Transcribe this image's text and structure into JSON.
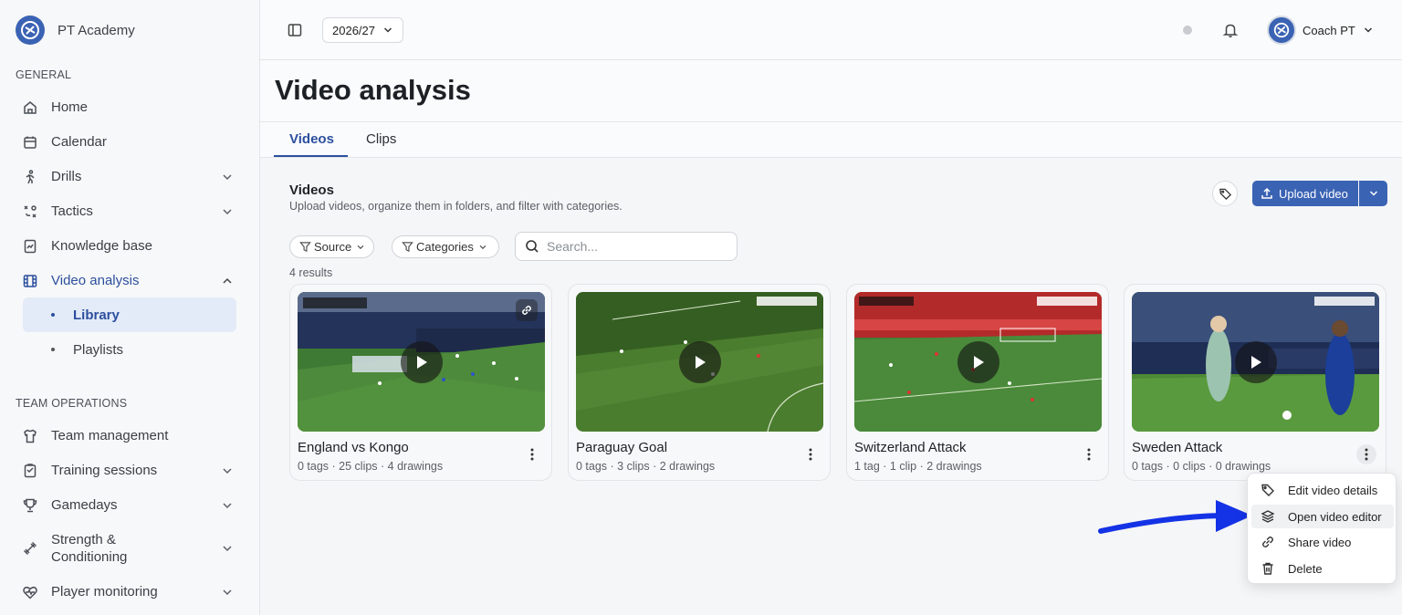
{
  "app": {
    "name": "PT Academy"
  },
  "sidebar": {
    "general_label": "GENERAL",
    "team_ops_label": "TEAM OPERATIONS",
    "items": [
      {
        "label": "Home",
        "icon": "home-icon"
      },
      {
        "label": "Calendar",
        "icon": "calendar-icon"
      },
      {
        "label": "Drills",
        "icon": "run-icon"
      },
      {
        "label": "Tactics",
        "icon": "tactics-icon"
      },
      {
        "label": "Knowledge base",
        "icon": "book-icon"
      },
      {
        "label": "Video analysis",
        "icon": "film-icon"
      }
    ],
    "video_sub": [
      {
        "label": "Library"
      },
      {
        "label": "Playlists"
      }
    ],
    "team_items": [
      {
        "label": "Team management",
        "icon": "shirt-icon"
      },
      {
        "label": "Training sessions",
        "icon": "clipboard-icon"
      },
      {
        "label": "Gamedays",
        "icon": "trophy-icon"
      },
      {
        "label": "Strength & Conditioning",
        "icon": "dumbbell-icon"
      },
      {
        "label": "Player monitoring",
        "icon": "heart-pulse-icon"
      }
    ]
  },
  "topbar": {
    "season": "2026/27",
    "user_name": "Coach PT"
  },
  "page": {
    "title": "Video analysis",
    "tabs": [
      {
        "label": "Videos"
      },
      {
        "label": "Clips"
      }
    ]
  },
  "videos_section": {
    "title": "Videos",
    "description": "Upload videos, organize them in folders, and filter with categories.",
    "upload_label": "Upload video",
    "filters": [
      {
        "label": "Source"
      },
      {
        "label": "Categories"
      }
    ],
    "search_placeholder": "Search...",
    "results": "4 results"
  },
  "cards": [
    {
      "title": "England vs Kongo",
      "meta": "0 tags · 25 clips · 4 drawings"
    },
    {
      "title": "Paraguay Goal",
      "meta": "0 tags · 3 clips · 2 drawings"
    },
    {
      "title": "Switzerland Attack",
      "meta": "1 tag · 1 clip · 2 drawings"
    },
    {
      "title": "Sweden Attack",
      "meta": "0 tags · 0 clips · 0 drawings"
    }
  ],
  "menu": {
    "items": [
      {
        "label": "Edit video details",
        "icon": "tag-icon"
      },
      {
        "label": "Open video editor",
        "icon": "layers-icon"
      },
      {
        "label": "Share video",
        "icon": "link-icon"
      },
      {
        "label": "Delete",
        "icon": "trash-icon"
      }
    ]
  },
  "colors": {
    "accent": "#3b63b4",
    "active_text": "#2c4f9e",
    "annotation_arrow": "#1433e6"
  }
}
